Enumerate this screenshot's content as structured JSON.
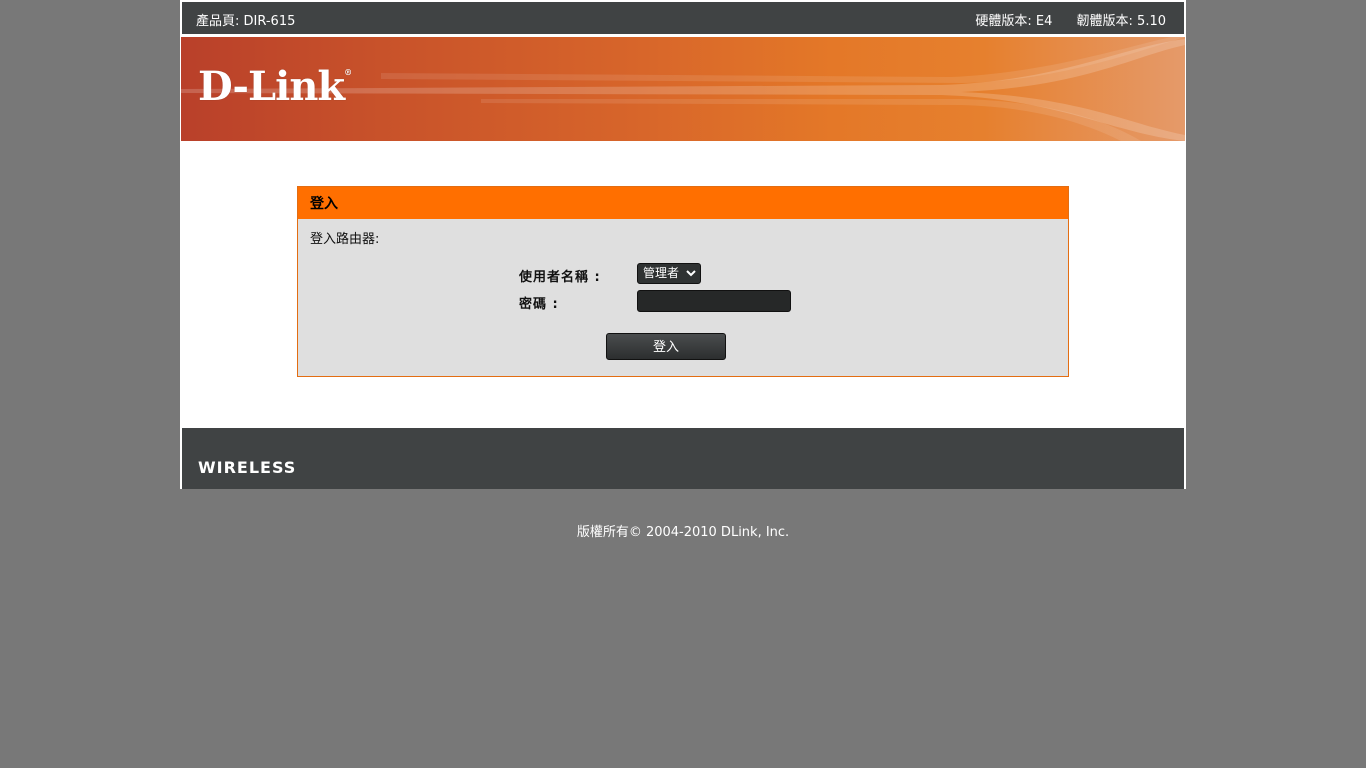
{
  "topbar": {
    "product": "產品頁: DIR-615",
    "hardware_version": "硬體版本: E4",
    "firmware_version": "韌體版本: 5.10"
  },
  "banner": {
    "logo_text": "D-Link",
    "logo_mark": "®"
  },
  "login": {
    "header": "登入",
    "intro": "登入路由器:",
    "username_label": "使用者名稱 :",
    "username_value": "管理者",
    "password_label": "密碼 :",
    "password_value": "",
    "button_label": "登入"
  },
  "footer": {
    "brand": "WIRELESS",
    "copyright": "版權所有© 2004-2010 DLink, Inc."
  },
  "colors": {
    "page_bg": "#787878",
    "bar_bg": "#404344",
    "accent": "#ff6f00",
    "panel_bg": "#dfdfdf"
  },
  "icons": {
    "select_arrow": "chevron-down-icon"
  }
}
